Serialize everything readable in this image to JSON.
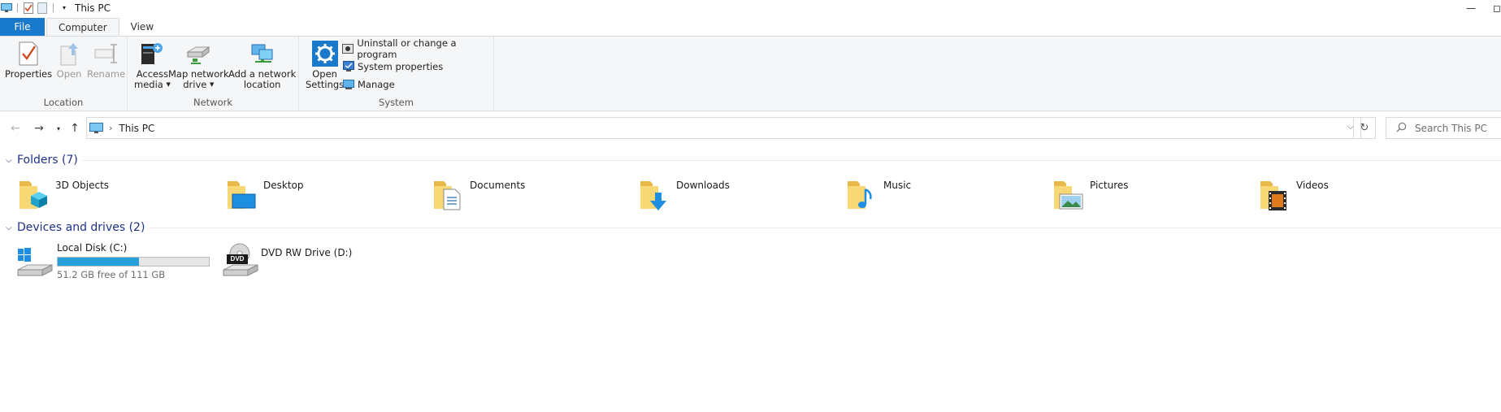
{
  "window": {
    "title": "This PC",
    "minimize_glyph": "—",
    "edge_glyph": "◻"
  },
  "tabs": [
    {
      "label": "File"
    },
    {
      "label": "Computer"
    },
    {
      "label": "View"
    }
  ],
  "ribbon": {
    "location": {
      "label": "Location",
      "properties": "Properties",
      "open": "Open",
      "rename": "Rename"
    },
    "network": {
      "label": "Network",
      "access_media_1": "Access",
      "access_media_2": "media",
      "map_drive_1": "Map network",
      "map_drive_2": "drive",
      "add_location_1": "Add a network",
      "add_location_2": "location"
    },
    "system": {
      "label": "System",
      "open_settings_1": "Open",
      "open_settings_2": "Settings",
      "uninstall": "Uninstall or change a program",
      "system_properties": "System properties",
      "manage": "Manage"
    }
  },
  "address": {
    "crumb": "This PC",
    "search_placeholder": "Search This PC"
  },
  "folders_section": {
    "title": "Folders (7)",
    "items": [
      {
        "name": "3D Objects",
        "icon": "3d-objects-icon"
      },
      {
        "name": "Desktop",
        "icon": "desktop-icon"
      },
      {
        "name": "Documents",
        "icon": "documents-icon"
      },
      {
        "name": "Downloads",
        "icon": "downloads-icon"
      },
      {
        "name": "Music",
        "icon": "music-icon"
      },
      {
        "name": "Pictures",
        "icon": "pictures-icon"
      },
      {
        "name": "Videos",
        "icon": "videos-icon"
      }
    ]
  },
  "drives_section": {
    "title": "Devices and drives (2)",
    "items": [
      {
        "name": "Local Disk (C:)",
        "free_text": "51.2 GB free of 111 GB",
        "used_fraction": 0.54
      },
      {
        "name": "DVD RW Drive (D:)",
        "badge": "DVD"
      }
    ]
  },
  "colors": {
    "accent": "#1979ca",
    "section_title": "#1e3287",
    "usage_bar": "#26a0da",
    "folder": "#f8d775"
  }
}
